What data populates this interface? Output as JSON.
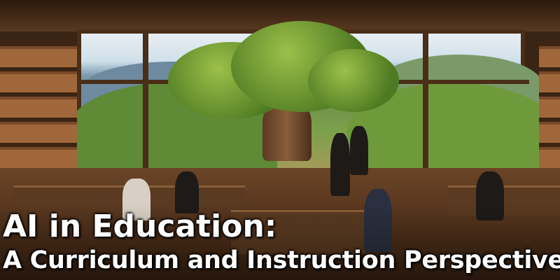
{
  "title": {
    "line1": "AI in Education:",
    "line2": "A Curriculum and Instruction Perspective"
  },
  "image": {
    "description_icon": "classroom-library-tree-illustration"
  }
}
